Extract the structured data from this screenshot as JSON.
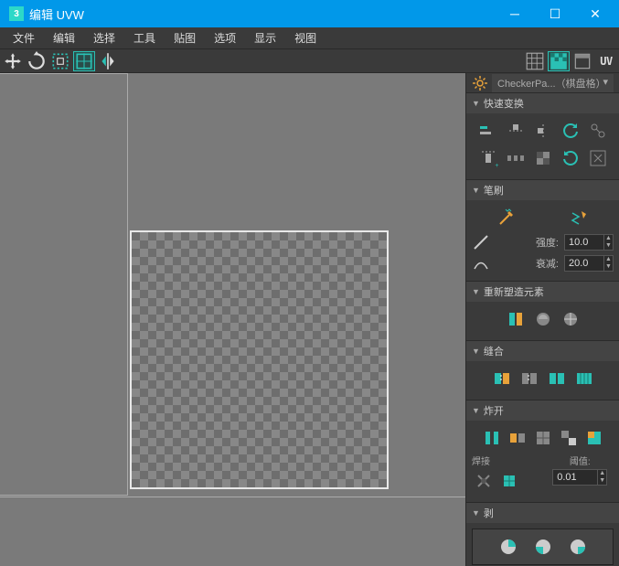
{
  "window": {
    "app_badge": "3",
    "title": "编辑 UVW"
  },
  "menu": [
    "文件",
    "编辑",
    "选择",
    "工具",
    "贴图",
    "选项",
    "显示",
    "视图"
  ],
  "toolbar_right_uv": "UV",
  "dropdown": {
    "label": "CheckerPa...（棋盘格）"
  },
  "panels": {
    "quick_transform": {
      "title": "快速变换"
    },
    "brush": {
      "title": "笔刷",
      "strength_label": "强度:",
      "strength_value": "10.0",
      "falloff_label": "衰减:",
      "falloff_value": "20.0"
    },
    "reshape": {
      "title": "重新塑造元素"
    },
    "stitch": {
      "title": "缝合"
    },
    "explode": {
      "title": "炸开",
      "weld_label": "焊接",
      "threshold_label": "阈值:",
      "threshold_value": "0.01"
    },
    "peel": {
      "title": "剥"
    }
  }
}
